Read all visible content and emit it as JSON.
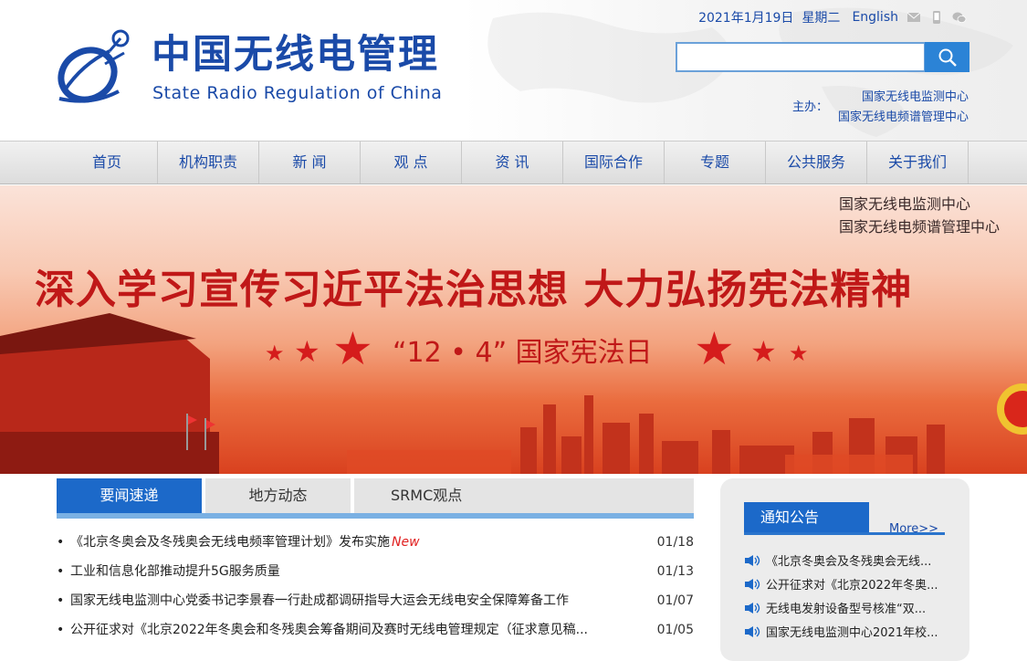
{
  "header": {
    "title_cn": "中国无线电管理",
    "title_en": "State Radio Regulation  of China",
    "date": "2021年1月19日",
    "weekday": "星期二",
    "english_link": "English",
    "sponsor_label": "主办：",
    "sponsor_1": "国家无线电监测中心",
    "sponsor_2": "国家无线电频谱管理中心",
    "search_placeholder": ""
  },
  "nav": [
    "首页",
    "机构职责",
    "新 闻",
    "观 点",
    "资 讯",
    "国际合作",
    "专题",
    "公共服务",
    "关于我们"
  ],
  "banner": {
    "org_1": "国家无线电监测中心",
    "org_2": "国家无线电频谱管理中心",
    "headline": "深入学习宣传习近平法治思想  大力弘扬宪法精神",
    "sub": "“12 • 4” 国家宪法日"
  },
  "tabs": [
    "要闻速递",
    "地方动态",
    "SRMC观点"
  ],
  "news": [
    {
      "title": "《北京冬奥会及冬残奥会无线电频率管理计划》发布实施",
      "badge": "New",
      "date": "01/18"
    },
    {
      "title": "工业和信息化部推动提升5G服务质量",
      "badge": "",
      "date": "01/13"
    },
    {
      "title": "国家无线电监测中心党委书记李景春一行赴成都调研指导大运会无线电安全保障筹备工作",
      "badge": "",
      "date": "01/07"
    },
    {
      "title": "公开征求对《北京2022年冬奥会和冬残奥会筹备期间及赛时无线电管理规定（征求意见稿...",
      "badge": "",
      "date": "01/05"
    }
  ],
  "notice": {
    "title": "通知公告",
    "more": "More>>",
    "items": [
      "《北京冬奥会及冬残奥会无线...",
      "公开征求对《北京2022年冬奥...",
      "无线电发射设备型号核准“双...",
      "国家无线电监测中心2021年校..."
    ]
  },
  "colors": {
    "brand": "#1a4aa8",
    "accent": "#1c69c9",
    "headline": "#c01818"
  }
}
